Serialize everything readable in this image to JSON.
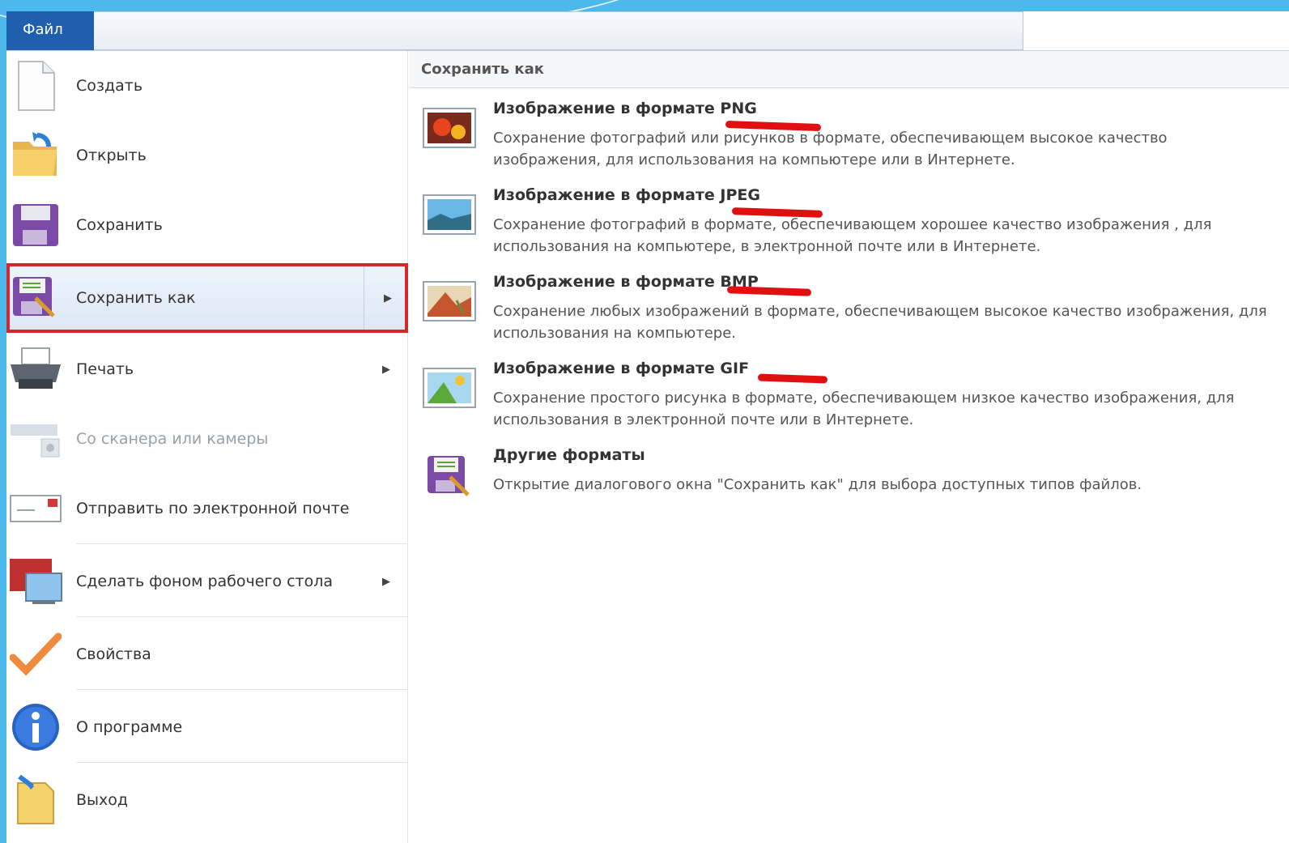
{
  "ribbon": {
    "file_tab": "Файл"
  },
  "left_menu": {
    "items": [
      {
        "label": "Создать",
        "icon": "new-document-icon"
      },
      {
        "label": "Открыть",
        "icon": "open-folder-icon"
      },
      {
        "label": "Сохранить",
        "icon": "floppy-disk-icon"
      },
      {
        "label": "Сохранить как",
        "icon": "save-as-icon",
        "selected": true
      },
      {
        "label": "Печать",
        "icon": "printer-icon"
      },
      {
        "label": "Со сканера или камеры",
        "icon": "scanner-icon",
        "disabled": true
      },
      {
        "label": "Отправить по электронной почте",
        "icon": "envelope-icon"
      },
      {
        "label": "Сделать фоном рабочего стола",
        "icon": "desktop-background-icon"
      },
      {
        "label": "Свойства",
        "icon": "checkmark-icon"
      },
      {
        "label": "О программе",
        "icon": "info-icon"
      },
      {
        "label": "Выход",
        "icon": "exit-icon"
      }
    ]
  },
  "right_pane": {
    "header": "Сохранить как",
    "formats": [
      {
        "title": "Изображение в формате PNG",
        "desc": "Сохранение фотографий или рисунков в формате, обеспечивающем высокое качество изображения, для использования на компьютере или в Интернете.",
        "icon": "png-image-icon"
      },
      {
        "title": "Изображение в формате JPEG",
        "desc": "Сохранение фотографий в формате, обеспечивающем хорошее качество изображения , для использования на компьютере, в электронной почте или в Интернете.",
        "icon": "jpeg-image-icon"
      },
      {
        "title": "Изображение в формате BMP",
        "desc": "Сохранение любых изображений в формате, обеспечивающем высокое качество изображения, для использования на компьютере.",
        "icon": "bmp-image-icon"
      },
      {
        "title": "Изображение в формате GIF",
        "desc": "Сохранение простого рисунка в формате, обеспечивающем низкое качество изображения, для использования в электронной почте или в Интернете.",
        "icon": "gif-image-icon"
      },
      {
        "title": "Другие форматы",
        "desc": "Открытие диалогового окна \"Сохранить как\" для выбора доступных типов файлов.",
        "icon": "save-as-icon"
      }
    ]
  },
  "colors": {
    "accent": "#1f5fae",
    "highlight_border": "#d7262c",
    "annotation": "#e01010",
    "background": "#4cb8ec"
  }
}
